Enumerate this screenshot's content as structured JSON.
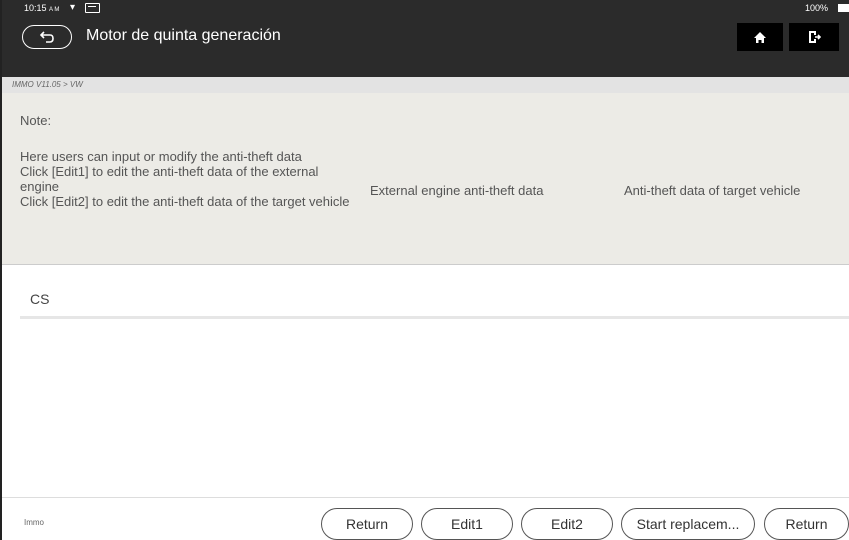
{
  "status_bar": {
    "time": "10:15",
    "ampm": "A M",
    "battery": "100%"
  },
  "header": {
    "title": "Motor de quinta generación",
    "icons": {
      "back": "back-arrow-icon",
      "home": "home-icon",
      "exit": "exit-icon"
    }
  },
  "breadcrumb": "IMMO V11.05 > VW",
  "note": {
    "title": "Note:",
    "lines": [
      "Here users can input or modify the anti-theft data",
      "Click [Edit1] to edit the anti-theft data of the external engine",
      "Click [Edit2] to edit the anti-theft data of the target vehicle"
    ],
    "columns": [
      "External engine anti-theft data",
      "Anti-theft data of target vehicle"
    ]
  },
  "table": {
    "rows": [
      {
        "label": "CS",
        "external": "",
        "target": ""
      }
    ]
  },
  "footer": {
    "label": "Immo",
    "buttons": [
      "Return",
      "Edit1",
      "Edit2",
      "Start replacem...",
      "Return"
    ]
  }
}
